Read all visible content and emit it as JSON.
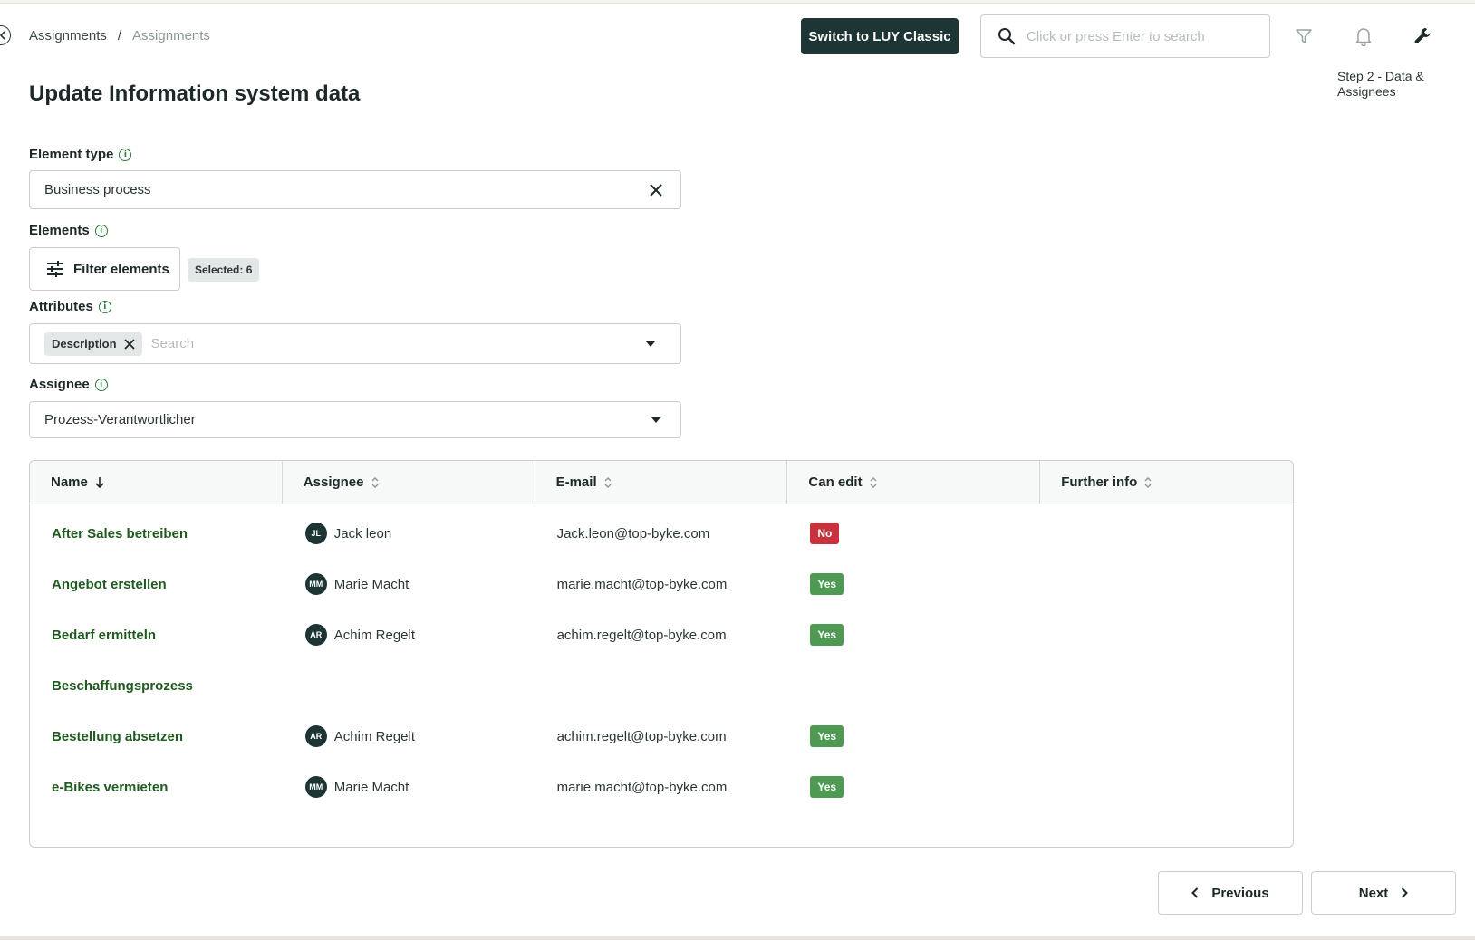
{
  "breadcrumb": {
    "first": "Assignments",
    "separator": "/",
    "current": "Assignments"
  },
  "header": {
    "switch_label": "Switch to LUY Classic",
    "search_placeholder": "Click or press Enter to search",
    "icons": [
      "filter-icon",
      "bell-icon",
      "wrench-icon"
    ]
  },
  "step_label": "Step 2 - Data & Assignees",
  "page_title": "Update Information system data",
  "element_type": {
    "label": "Element type",
    "value": "Business process"
  },
  "elements": {
    "label": "Elements",
    "filter_label": "Filter elements",
    "selected": "Selected: 6"
  },
  "attributes": {
    "label": "Attributes",
    "chip": "Description",
    "placeholder": "Search"
  },
  "assignee": {
    "label": "Assignee",
    "value": "Prozess-Verantwortlicher"
  },
  "table": {
    "columns": [
      "Name",
      "Assignee",
      "E-mail",
      "Can edit",
      "Further info"
    ],
    "rows": [
      {
        "name": "After Sales betreiben",
        "initials": "JL",
        "assignee": "Jack leon",
        "email": "Jack.leon@top-byke.com",
        "can_edit": "No"
      },
      {
        "name": "Angebot erstellen",
        "initials": "MM",
        "assignee": "Marie Macht",
        "email": "marie.macht@top-byke.com",
        "can_edit": "Yes"
      },
      {
        "name": "Bedarf ermitteln",
        "initials": "AR",
        "assignee": "Achim Regelt",
        "email": "achim.regelt@top-byke.com",
        "can_edit": "Yes"
      },
      {
        "name": "Beschaffungsprozess",
        "initials": "",
        "assignee": "",
        "email": "",
        "can_edit": ""
      },
      {
        "name": "Bestellung absetzen",
        "initials": "AR",
        "assignee": "Achim Regelt",
        "email": "achim.regelt@top-byke.com",
        "can_edit": "Yes"
      },
      {
        "name": "e-Bikes vermieten",
        "initials": "MM",
        "assignee": "Marie Macht",
        "email": "marie.macht@top-byke.com",
        "can_edit": "Yes"
      }
    ]
  },
  "colors": {
    "yes": "#4e9a52",
    "no": "#c8323c",
    "primary": "#1e3535",
    "link": "#1f5a1f"
  },
  "footer": {
    "previous": "Previous",
    "next": "Next"
  }
}
